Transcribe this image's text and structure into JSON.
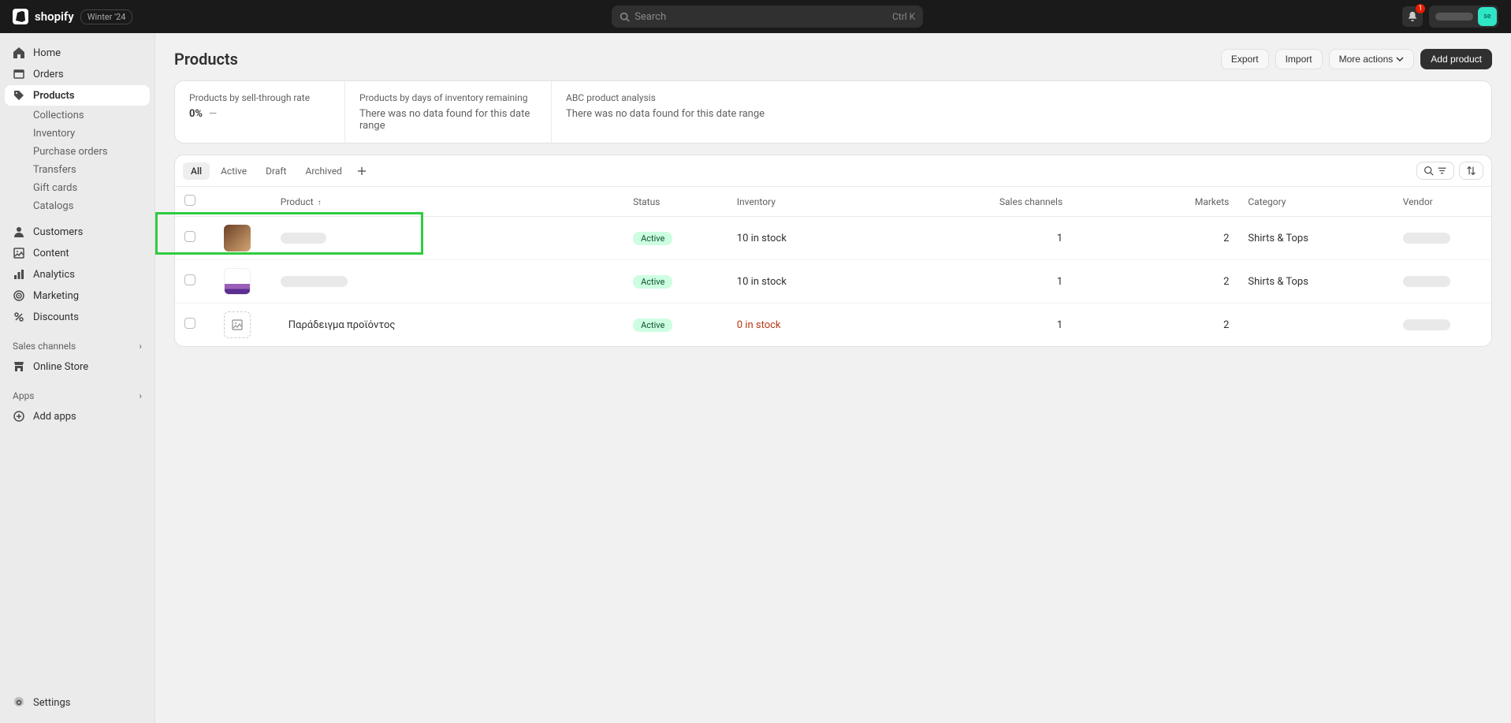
{
  "topbar": {
    "logo_text": "shopify",
    "version": "Winter '24",
    "search_placeholder": "Search",
    "search_kbd": "Ctrl K",
    "notification_count": "1",
    "avatar_initials": "se"
  },
  "sidebar": {
    "items": [
      {
        "label": "Home",
        "icon": "home"
      },
      {
        "label": "Orders",
        "icon": "orders"
      },
      {
        "label": "Products",
        "icon": "products",
        "active": true
      },
      {
        "label": "Customers",
        "icon": "customers"
      },
      {
        "label": "Content",
        "icon": "content"
      },
      {
        "label": "Analytics",
        "icon": "analytics"
      },
      {
        "label": "Marketing",
        "icon": "marketing"
      },
      {
        "label": "Discounts",
        "icon": "discounts"
      }
    ],
    "product_subs": [
      "Collections",
      "Inventory",
      "Purchase orders",
      "Transfers",
      "Gift cards",
      "Catalogs"
    ],
    "sales_channels_label": "Sales channels",
    "online_store_label": "Online Store",
    "apps_label": "Apps",
    "add_apps_label": "Add apps",
    "settings_label": "Settings"
  },
  "page": {
    "title": "Products",
    "actions": {
      "export": "Export",
      "import": "Import",
      "more": "More actions",
      "add": "Add product"
    }
  },
  "stats": [
    {
      "label": "Products by sell-through rate",
      "value": "0%",
      "dash": "—"
    },
    {
      "label": "Products by days of inventory remaining",
      "nodata": "There was no data found for this date range"
    },
    {
      "label": "ABC product analysis",
      "nodata": "There was no data found for this date range"
    }
  ],
  "tabs": [
    "All",
    "Active",
    "Draft",
    "Archived"
  ],
  "columns": {
    "product": "Product",
    "status": "Status",
    "inventory": "Inventory",
    "sales": "Sales channels",
    "markets": "Markets",
    "category": "Category",
    "vendor": "Vendor"
  },
  "rows": [
    {
      "name_redacted": true,
      "status": "Active",
      "inventory": "10 in stock",
      "inv_zero": false,
      "sales": "1",
      "markets": "2",
      "category": "Shirts & Tops",
      "vendor_redacted": true,
      "thumb": "img1"
    },
    {
      "name_redacted": true,
      "status": "Active",
      "inventory": "10 in stock",
      "inv_zero": false,
      "sales": "1",
      "markets": "2",
      "category": "Shirts & Tops",
      "vendor_redacted": true,
      "thumb": "img2"
    },
    {
      "name": "Παράδειγμα προϊόντος",
      "status": "Active",
      "inventory": "0 in stock",
      "inv_zero": true,
      "sales": "1",
      "markets": "2",
      "category": "",
      "vendor_redacted": true,
      "thumb": "placeholder",
      "highlighted": true
    }
  ]
}
